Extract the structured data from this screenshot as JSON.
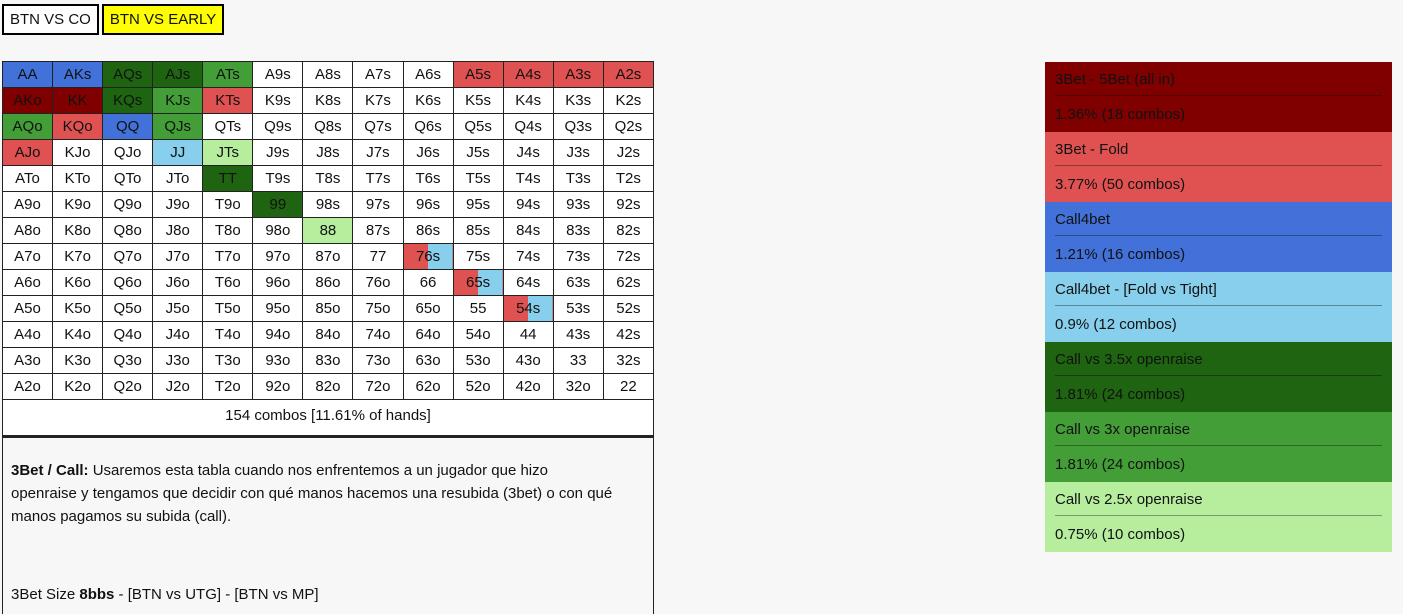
{
  "tabs": [
    {
      "label": "BTN VS CO",
      "active": false
    },
    {
      "label": "BTN VS EARLY",
      "active": true
    }
  ],
  "grid": {
    "rows": [
      [
        "AA",
        "AKs",
        "AQs",
        "AJs",
        "ATs",
        "A9s",
        "A8s",
        "A7s",
        "A6s",
        "A5s",
        "A4s",
        "A3s",
        "A2s"
      ],
      [
        "AKo",
        "KK",
        "KQs",
        "KJs",
        "KTs",
        "K9s",
        "K8s",
        "K7s",
        "K6s",
        "K5s",
        "K4s",
        "K3s",
        "K2s"
      ],
      [
        "AQo",
        "KQo",
        "QQ",
        "QJs",
        "QTs",
        "Q9s",
        "Q8s",
        "Q7s",
        "Q6s",
        "Q5s",
        "Q4s",
        "Q3s",
        "Q2s"
      ],
      [
        "AJo",
        "KJo",
        "QJo",
        "JJ",
        "JTs",
        "J9s",
        "J8s",
        "J7s",
        "J6s",
        "J5s",
        "J4s",
        "J3s",
        "J2s"
      ],
      [
        "ATo",
        "KTo",
        "QTo",
        "JTo",
        "TT",
        "T9s",
        "T8s",
        "T7s",
        "T6s",
        "T5s",
        "T4s",
        "T3s",
        "T2s"
      ],
      [
        "A9o",
        "K9o",
        "Q9o",
        "J9o",
        "T9o",
        "99",
        "98s",
        "97s",
        "96s",
        "95s",
        "94s",
        "93s",
        "92s"
      ],
      [
        "A8o",
        "K8o",
        "Q8o",
        "J8o",
        "T8o",
        "98o",
        "88",
        "87s",
        "86s",
        "85s",
        "84s",
        "83s",
        "82s"
      ],
      [
        "A7o",
        "K7o",
        "Q7o",
        "J7o",
        "T7o",
        "97o",
        "87o",
        "77",
        "76s",
        "75s",
        "74s",
        "73s",
        "72s"
      ],
      [
        "A6o",
        "K6o",
        "Q6o",
        "J6o",
        "T6o",
        "96o",
        "86o",
        "76o",
        "66",
        "65s",
        "64s",
        "63s",
        "62s"
      ],
      [
        "A5o",
        "K5o",
        "Q5o",
        "J5o",
        "T5o",
        "95o",
        "85o",
        "75o",
        "65o",
        "55",
        "54s",
        "53s",
        "52s"
      ],
      [
        "A4o",
        "K4o",
        "Q4o",
        "J4o",
        "T4o",
        "94o",
        "84o",
        "74o",
        "64o",
        "54o",
        "44",
        "43s",
        "42s"
      ],
      [
        "A3o",
        "K3o",
        "Q3o",
        "J3o",
        "T3o",
        "93o",
        "83o",
        "73o",
        "63o",
        "53o",
        "43o",
        "33",
        "32s"
      ],
      [
        "A2o",
        "K2o",
        "Q2o",
        "J2o",
        "T2o",
        "92o",
        "82o",
        "72o",
        "62o",
        "52o",
        "42o",
        "32o",
        "22"
      ]
    ],
    "hand_actions": {
      "AA": "call4bet",
      "AKs": "call4bet",
      "AQs": "call_35x",
      "AJs": "call_35x",
      "ATs": "call_3x",
      "A5s": "bet3_fold",
      "A4s": "bet3_fold",
      "A3s": "bet3_fold",
      "A2s": "bet3_fold",
      "AKo": "bet3_allin",
      "KK": "bet3_allin",
      "KQs": "call_35x",
      "KJs": "call_3x",
      "KTs": "bet3_fold",
      "AQo": "call_3x",
      "KQo": "bet3_fold",
      "QQ": "call4bet",
      "QJs": "call_3x",
      "AJo": "bet3_fold",
      "JJ": "call4bet_fold_tight",
      "JTs": "call_25x",
      "TT": "call_35x",
      "99": "call_35x",
      "88": "call_25x"
    },
    "split_hands": {
      "76s": [
        "bet3_fold",
        "call4bet_fold_tight"
      ],
      "65s": [
        "bet3_fold",
        "call4bet_fold_tight"
      ],
      "54s": [
        "bet3_fold",
        "call4bet_fold_tight"
      ]
    },
    "summary": "154 combos [11.61% of hands]"
  },
  "description": {
    "title": "3Bet / Call:",
    "text": " Usaremos esta tabla cuando nos enfrentemos a un jugador que hizo openraise y tengamos que decidir con qué manos hacemos una resubida (3bet) o con qué manos pagamos su subida (call).",
    "size_prefix": "3Bet Size ",
    "size_value": "8bbs",
    "size_suffix": " - [BTN vs UTG] - [BTN vs MP]"
  },
  "legend": [
    {
      "key": "bet3_allin",
      "label": "3Bet - 5Bet (all in)",
      "value": "1.36%  (18 combos)",
      "color": "#800000",
      "text_color": "#111111"
    },
    {
      "key": "bet3_fold",
      "label": "3Bet - Fold",
      "value": "3.77%  (50 combos)",
      "color": "#e05252",
      "text_color": "#111111"
    },
    {
      "key": "call4bet",
      "label": "Call4bet",
      "value": "1.21%  (16 combos)",
      "color": "#4272d9",
      "text_color": "#111111"
    },
    {
      "key": "call4bet_fold_tight",
      "label": "Call4bet - [Fold vs Tight]",
      "value": "0.9%  (12 combos)",
      "color": "#87cfec",
      "text_color": "#111111"
    },
    {
      "key": "call_35x",
      "label": "Call vs 3.5x openraise",
      "value": "1.81%  (24 combos)",
      "color": "#1f6410",
      "text_color": "#111111"
    },
    {
      "key": "call_3x",
      "label": "Call vs 3x openraise",
      "value": "1.81%  (24 combos)",
      "color": "#449e38",
      "text_color": "#111111"
    },
    {
      "key": "call_25x",
      "label": "Call vs 2.5x openraise",
      "value": "0.75%  (10 combos)",
      "color": "#b6ee9e",
      "text_color": "#111111"
    }
  ]
}
